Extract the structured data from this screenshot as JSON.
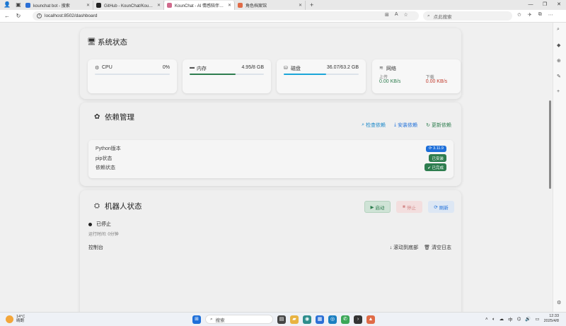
{
  "browser": {
    "tabs": [
      {
        "title": "kounchat bot - 搜索",
        "favicon_color": "#2b6fd6"
      },
      {
        "title": "GitHub - KounChat/KounChat: 基...",
        "favicon_color": "#222222"
      },
      {
        "title": "KounChat - AI 情感陪伴系统控制...",
        "favicon_color": "#d06a8c"
      },
      {
        "title": "角色档案馆",
        "favicon_color": "#e06b47"
      }
    ],
    "url": "localhost:8502/dashboard",
    "search_placeholder": "点此搜索"
  },
  "system": {
    "title": "系统状态",
    "cpu": {
      "label": "CPU",
      "value": "0%",
      "percent": 0
    },
    "memory": {
      "label": "内存",
      "value": "4.95/8 GB",
      "percent": 62,
      "color": "#2e7d4f"
    },
    "disk": {
      "label": "磁盘",
      "value": "36.07/63.2 GB",
      "percent": 57,
      "color": "#1ba6d9"
    },
    "network": {
      "label": "网络",
      "upload_label": "上传",
      "download_label": "下载",
      "upload": "0.00 KB/s",
      "download": "0.00 KB/s"
    }
  },
  "deps": {
    "title": "依赖管理",
    "check": "检查依赖",
    "install": "安装依赖",
    "update": "更新依赖",
    "rows": [
      {
        "label": "Python版本",
        "badge": "3.11.9",
        "color": "#1e6fd9"
      },
      {
        "label": "pip状态",
        "badge": "已安装",
        "color": "#2e7d4f"
      },
      {
        "label": "依赖状态",
        "badge": "已完成",
        "color": "#2e7d4f"
      }
    ]
  },
  "bot": {
    "title": "机器人状态",
    "start": "启动",
    "stop": "停止",
    "refresh": "刷新",
    "status": "已停止",
    "runtime": "运行时间: 0分钟",
    "console": "控制台",
    "scroll_bottom": "滚动到底部",
    "clear_log": "清空日志"
  },
  "taskbar": {
    "temp": "14°C",
    "weather": "晴朗",
    "search": "搜索",
    "ime": "中",
    "time": "12:33",
    "date": "2025/4/8"
  }
}
